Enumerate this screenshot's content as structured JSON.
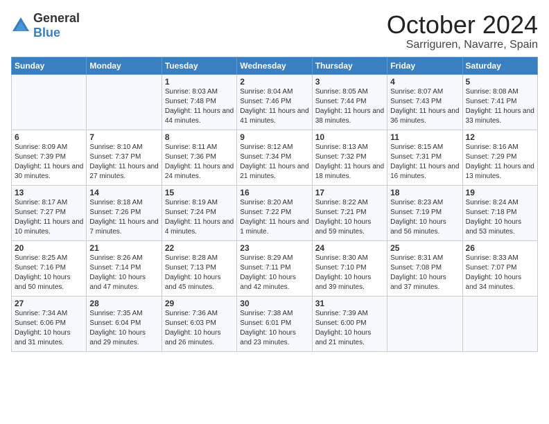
{
  "logo": {
    "text_general": "General",
    "text_blue": "Blue"
  },
  "title": "October 2024",
  "location": "Sarriguren, Navarre, Spain",
  "headers": [
    "Sunday",
    "Monday",
    "Tuesday",
    "Wednesday",
    "Thursday",
    "Friday",
    "Saturday"
  ],
  "weeks": [
    [
      {
        "day": "",
        "info": ""
      },
      {
        "day": "",
        "info": ""
      },
      {
        "day": "1",
        "info": "Sunrise: 8:03 AM\nSunset: 7:48 PM\nDaylight: 11 hours and 44 minutes."
      },
      {
        "day": "2",
        "info": "Sunrise: 8:04 AM\nSunset: 7:46 PM\nDaylight: 11 hours and 41 minutes."
      },
      {
        "day": "3",
        "info": "Sunrise: 8:05 AM\nSunset: 7:44 PM\nDaylight: 11 hours and 38 minutes."
      },
      {
        "day": "4",
        "info": "Sunrise: 8:07 AM\nSunset: 7:43 PM\nDaylight: 11 hours and 36 minutes."
      },
      {
        "day": "5",
        "info": "Sunrise: 8:08 AM\nSunset: 7:41 PM\nDaylight: 11 hours and 33 minutes."
      }
    ],
    [
      {
        "day": "6",
        "info": "Sunrise: 8:09 AM\nSunset: 7:39 PM\nDaylight: 11 hours and 30 minutes."
      },
      {
        "day": "7",
        "info": "Sunrise: 8:10 AM\nSunset: 7:37 PM\nDaylight: 11 hours and 27 minutes."
      },
      {
        "day": "8",
        "info": "Sunrise: 8:11 AM\nSunset: 7:36 PM\nDaylight: 11 hours and 24 minutes."
      },
      {
        "day": "9",
        "info": "Sunrise: 8:12 AM\nSunset: 7:34 PM\nDaylight: 11 hours and 21 minutes."
      },
      {
        "day": "10",
        "info": "Sunrise: 8:13 AM\nSunset: 7:32 PM\nDaylight: 11 hours and 18 minutes."
      },
      {
        "day": "11",
        "info": "Sunrise: 8:15 AM\nSunset: 7:31 PM\nDaylight: 11 hours and 16 minutes."
      },
      {
        "day": "12",
        "info": "Sunrise: 8:16 AM\nSunset: 7:29 PM\nDaylight: 11 hours and 13 minutes."
      }
    ],
    [
      {
        "day": "13",
        "info": "Sunrise: 8:17 AM\nSunset: 7:27 PM\nDaylight: 11 hours and 10 minutes."
      },
      {
        "day": "14",
        "info": "Sunrise: 8:18 AM\nSunset: 7:26 PM\nDaylight: 11 hours and 7 minutes."
      },
      {
        "day": "15",
        "info": "Sunrise: 8:19 AM\nSunset: 7:24 PM\nDaylight: 11 hours and 4 minutes."
      },
      {
        "day": "16",
        "info": "Sunrise: 8:20 AM\nSunset: 7:22 PM\nDaylight: 11 hours and 1 minute."
      },
      {
        "day": "17",
        "info": "Sunrise: 8:22 AM\nSunset: 7:21 PM\nDaylight: 10 hours and 59 minutes."
      },
      {
        "day": "18",
        "info": "Sunrise: 8:23 AM\nSunset: 7:19 PM\nDaylight: 10 hours and 56 minutes."
      },
      {
        "day": "19",
        "info": "Sunrise: 8:24 AM\nSunset: 7:18 PM\nDaylight: 10 hours and 53 minutes."
      }
    ],
    [
      {
        "day": "20",
        "info": "Sunrise: 8:25 AM\nSunset: 7:16 PM\nDaylight: 10 hours and 50 minutes."
      },
      {
        "day": "21",
        "info": "Sunrise: 8:26 AM\nSunset: 7:14 PM\nDaylight: 10 hours and 47 minutes."
      },
      {
        "day": "22",
        "info": "Sunrise: 8:28 AM\nSunset: 7:13 PM\nDaylight: 10 hours and 45 minutes."
      },
      {
        "day": "23",
        "info": "Sunrise: 8:29 AM\nSunset: 7:11 PM\nDaylight: 10 hours and 42 minutes."
      },
      {
        "day": "24",
        "info": "Sunrise: 8:30 AM\nSunset: 7:10 PM\nDaylight: 10 hours and 39 minutes."
      },
      {
        "day": "25",
        "info": "Sunrise: 8:31 AM\nSunset: 7:08 PM\nDaylight: 10 hours and 37 minutes."
      },
      {
        "day": "26",
        "info": "Sunrise: 8:33 AM\nSunset: 7:07 PM\nDaylight: 10 hours and 34 minutes."
      }
    ],
    [
      {
        "day": "27",
        "info": "Sunrise: 7:34 AM\nSunset: 6:06 PM\nDaylight: 10 hours and 31 minutes."
      },
      {
        "day": "28",
        "info": "Sunrise: 7:35 AM\nSunset: 6:04 PM\nDaylight: 10 hours and 29 minutes."
      },
      {
        "day": "29",
        "info": "Sunrise: 7:36 AM\nSunset: 6:03 PM\nDaylight: 10 hours and 26 minutes."
      },
      {
        "day": "30",
        "info": "Sunrise: 7:38 AM\nSunset: 6:01 PM\nDaylight: 10 hours and 23 minutes."
      },
      {
        "day": "31",
        "info": "Sunrise: 7:39 AM\nSunset: 6:00 PM\nDaylight: 10 hours and 21 minutes."
      },
      {
        "day": "",
        "info": ""
      },
      {
        "day": "",
        "info": ""
      }
    ]
  ]
}
